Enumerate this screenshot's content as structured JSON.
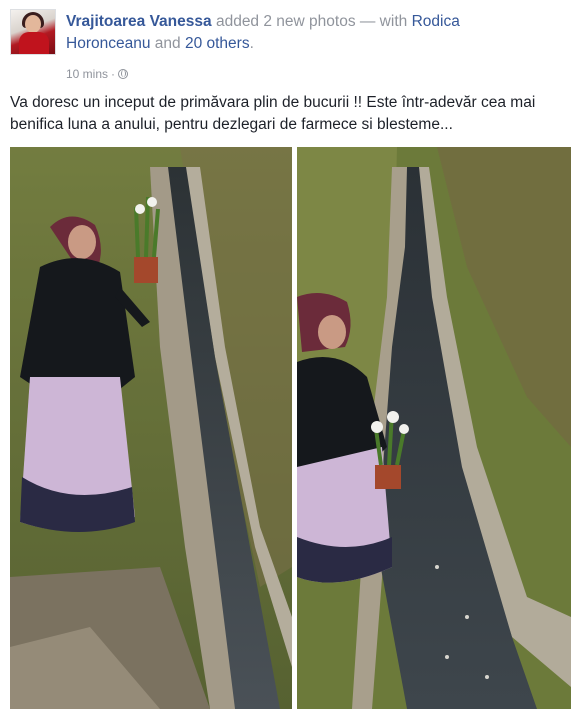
{
  "post": {
    "author": "Vrajitoarea Vanessa",
    "action": "added 2 new photos — with",
    "tagged_person": "Rodica Horonceanu",
    "conjunction": "and",
    "others": "20 others",
    "end_punct": ".",
    "time": "10 mins",
    "separator": "·",
    "privacy_icon": "globe-icon",
    "message": "Va doresc un inceput de primăvara plin de bucurii !! Este într-adevăr cea mai benifica luna a anului, pentru dezlegari de farmece si blesteme..."
  },
  "photos": [
    {
      "name": "photo-woman-standing-by-stream"
    },
    {
      "name": "photo-woman-crouching-by-stream"
    }
  ],
  "colors": {
    "link": "#365899",
    "meta": "#90949c",
    "text": "#1d2129"
  }
}
